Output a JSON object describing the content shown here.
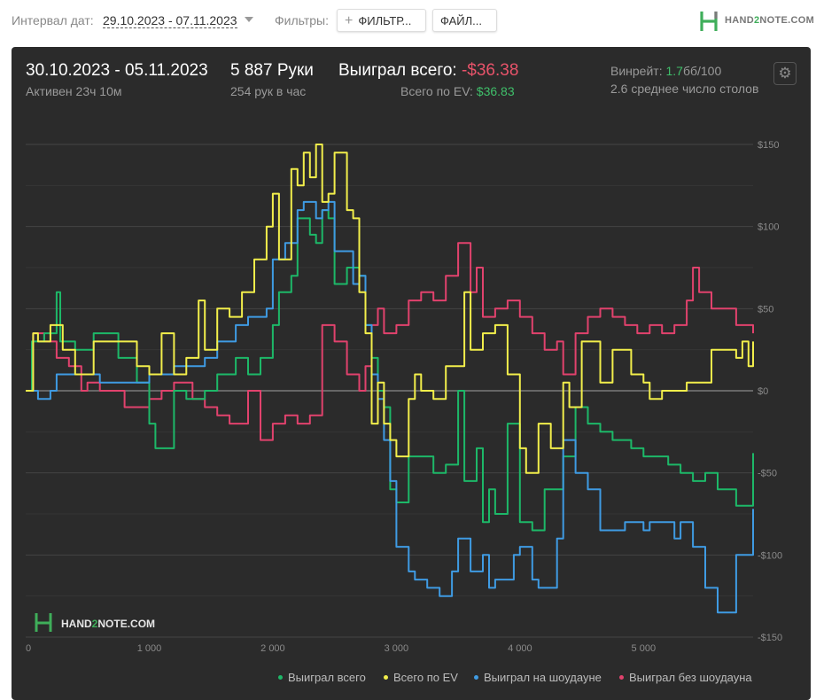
{
  "toolbar": {
    "date_interval_label": "Интервал дат:",
    "date_range": "29.10.2023 - 07.11.2023",
    "filters_label": "Фильтры:",
    "filter_button": "ФИЛЬТР...",
    "file_button": "ФАЙЛ...",
    "logo_left": "HAND",
    "logo_mid": "2",
    "logo_right": "NOTE.COM"
  },
  "summary": {
    "period": "30.10.2023 - 05.11.2023",
    "active": "Активен 23ч 10м",
    "hands": "5 887 Руки",
    "hands_per_hour": "254 рук в час",
    "won_total_label": "Выиграл всего:",
    "won_total_value": "-$36.38",
    "ev_label": "Всего по EV:",
    "ev_value": "$36.83",
    "winrate_label": "Винрейт:",
    "winrate_value": "1.7",
    "winrate_unit": "бб/100",
    "avg_tables": "2.6 среднее число столов"
  },
  "watermark": {
    "left": "HAND",
    "mid": "2",
    "right": "NOTE.COM"
  },
  "colors": {
    "won": "#1db868",
    "ev": "#f2ee4b",
    "showdown": "#3f9be3",
    "non_showdown": "#e1426d",
    "panel": "#2b2b2b"
  },
  "chart_data": {
    "type": "line",
    "xlim": [
      0,
      5887
    ],
    "ylim": [
      -150,
      150
    ],
    "x_ticks": [
      0,
      1000,
      2000,
      3000,
      4000,
      5000
    ],
    "x_tick_labels": [
      "0",
      "1 000",
      "2 000",
      "3 000",
      "4 000",
      "5 000"
    ],
    "y_ticks": [
      150,
      100,
      50,
      0,
      -50,
      -100,
      -150
    ],
    "y_tick_labels": [
      "$150",
      "$100",
      "$50",
      "$0",
      "-$50",
      "-$100",
      "-$150"
    ],
    "grid": true,
    "legend_position": "bottom-right",
    "series": [
      {
        "name": "Выиграл всего",
        "color_key": "won",
        "x": [
          0,
          50,
          150,
          250,
          280,
          400,
          550,
          750,
          900,
          1000,
          1050,
          1200,
          1300,
          1450,
          1550,
          1700,
          1800,
          1900,
          2000,
          2050,
          2150,
          2200,
          2300,
          2350,
          2400,
          2450,
          2500,
          2600,
          2700,
          2750,
          2800,
          2850,
          2900,
          2950,
          3000,
          3100,
          3300,
          3400,
          3500,
          3550,
          3650,
          3700,
          3750,
          3800,
          3900,
          4000,
          4100,
          4200,
          4300,
          4350,
          4450,
          4550,
          4650,
          4750,
          4900,
          5000,
          5100,
          5200,
          5300,
          5400,
          5500,
          5600,
          5750,
          5850,
          5887
        ],
        "y": [
          0,
          30,
          35,
          60,
          30,
          25,
          35,
          20,
          5,
          -20,
          -35,
          0,
          -5,
          0,
          10,
          20,
          10,
          20,
          40,
          60,
          70,
          105,
          95,
          90,
          110,
          105,
          65,
          75,
          70,
          40,
          20,
          0,
          -10,
          -60,
          -68,
          -40,
          -50,
          -45,
          0,
          -55,
          -35,
          -80,
          -60,
          -75,
          -20,
          -80,
          -85,
          -60,
          -60,
          -40,
          -10,
          -20,
          -25,
          -30,
          -35,
          -40,
          -40,
          -45,
          -50,
          -55,
          -50,
          -60,
          -70,
          -70,
          -38
        ]
      },
      {
        "name": "Всего по EV",
        "color_key": "ev",
        "x": [
          0,
          60,
          100,
          200,
          300,
          400,
          550,
          700,
          900,
          1000,
          1100,
          1200,
          1300,
          1400,
          1450,
          1550,
          1650,
          1750,
          1850,
          1950,
          2000,
          2050,
          2150,
          2200,
          2250,
          2300,
          2350,
          2400,
          2450,
          2500,
          2600,
          2650,
          2700,
          2750,
          2800,
          2850,
          2900,
          2950,
          3000,
          3100,
          3150,
          3200,
          3300,
          3400,
          3550,
          3600,
          3700,
          3800,
          3900,
          4000,
          4050,
          4150,
          4250,
          4350,
          4400,
          4500,
          4550,
          4650,
          4750,
          4900,
          5000,
          5050,
          5150,
          5250,
          5350,
          5450,
          5550,
          5650,
          5750,
          5800,
          5850,
          5887
        ],
        "y": [
          0,
          35,
          30,
          40,
          25,
          10,
          30,
          30,
          15,
          10,
          35,
          10,
          20,
          55,
          25,
          50,
          45,
          60,
          80,
          100,
          120,
          80,
          135,
          125,
          145,
          130,
          150,
          115,
          120,
          145,
          110,
          105,
          60,
          35,
          -20,
          5,
          -20,
          -30,
          -40,
          -5,
          10,
          0,
          -5,
          15,
          60,
          25,
          35,
          40,
          10,
          -35,
          -50,
          -20,
          -35,
          5,
          -10,
          30,
          30,
          5,
          25,
          10,
          5,
          -5,
          0,
          0,
          5,
          5,
          25,
          25,
          20,
          30,
          15,
          30
        ]
      },
      {
        "name": "Выиграл на шоудауне",
        "color_key": "showdown",
        "x": [
          0,
          100,
          200,
          250,
          400,
          600,
          900,
          1000,
          1200,
          1450,
          1550,
          1700,
          1800,
          1950,
          2000,
          2100,
          2200,
          2250,
          2350,
          2400,
          2450,
          2500,
          2650,
          2700,
          2750,
          2800,
          2850,
          2900,
          2950,
          3000,
          3100,
          3150,
          3250,
          3350,
          3450,
          3500,
          3600,
          3700,
          3750,
          3800,
          3950,
          4000,
          4100,
          4150,
          4300,
          4350,
          4450,
          4550,
          4650,
          4750,
          4850,
          5000,
          5050,
          5150,
          5250,
          5300,
          5400,
          5500,
          5600,
          5750,
          5850,
          5887
        ],
        "y": [
          0,
          -5,
          0,
          10,
          10,
          5,
          5,
          10,
          15,
          20,
          30,
          40,
          45,
          50,
          80,
          90,
          110,
          115,
          105,
          110,
          115,
          85,
          65,
          70,
          40,
          10,
          -5,
          -30,
          -55,
          -95,
          -110,
          -115,
          -120,
          -125,
          -110,
          -90,
          -110,
          -100,
          -120,
          -115,
          -100,
          -95,
          -115,
          -120,
          -90,
          -30,
          -50,
          -60,
          -85,
          -85,
          -80,
          -85,
          -80,
          -80,
          -90,
          -80,
          -95,
          -120,
          -135,
          -100,
          -100,
          -72
        ]
      },
      {
        "name": "Выиграл без шоудауна",
        "color_key": "non_showdown",
        "x": [
          0,
          60,
          150,
          250,
          350,
          450,
          500,
          600,
          700,
          800,
          900,
          1000,
          1100,
          1200,
          1350,
          1450,
          1550,
          1650,
          1800,
          1900,
          2000,
          2100,
          2200,
          2300,
          2400,
          2500,
          2600,
          2700,
          2750,
          2800,
          2850,
          2900,
          3000,
          3100,
          3200,
          3300,
          3400,
          3500,
          3600,
          3650,
          3700,
          3800,
          3900,
          4000,
          4100,
          4200,
          4300,
          4350,
          4450,
          4550,
          4650,
          4750,
          4850,
          4950,
          5050,
          5150,
          5250,
          5350,
          5400,
          5450,
          5550,
          5650,
          5750,
          5850,
          5887
        ],
        "y": [
          0,
          35,
          30,
          20,
          15,
          0,
          5,
          0,
          0,
          -10,
          -10,
          -5,
          0,
          5,
          -5,
          -10,
          -15,
          -20,
          0,
          -30,
          -20,
          -15,
          -20,
          -15,
          40,
          30,
          10,
          0,
          15,
          40,
          50,
          35,
          40,
          55,
          60,
          55,
          70,
          90,
          60,
          75,
          45,
          50,
          55,
          45,
          35,
          25,
          30,
          10,
          35,
          45,
          50,
          45,
          40,
          35,
          40,
          35,
          40,
          55,
          75,
          60,
          50,
          50,
          40,
          40,
          35
        ]
      }
    ]
  }
}
